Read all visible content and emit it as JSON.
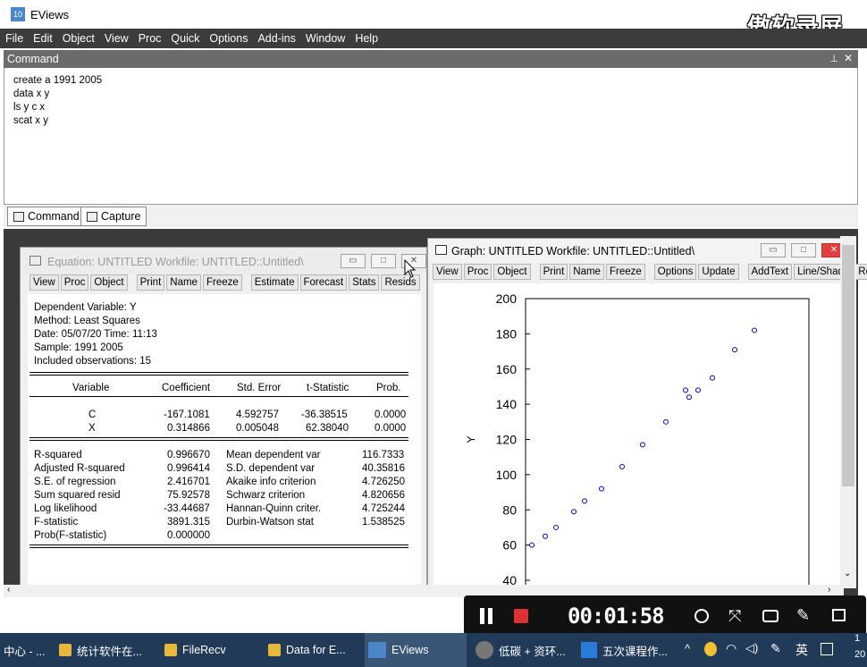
{
  "app": {
    "title": "EViews",
    "watermark": "傲软录屏"
  },
  "menu": [
    "File",
    "Edit",
    "Object",
    "View",
    "Proc",
    "Quick",
    "Options",
    "Add-ins",
    "Window",
    "Help"
  ],
  "command": {
    "header": "Command",
    "lines": [
      "create a 1991 2005",
      "data x y",
      "ls y c x",
      "scat x y"
    ],
    "tabs": [
      "Command",
      "Capture"
    ]
  },
  "equation": {
    "title": "Equation: UNTITLED   Workfile: UNTITLED::Untitled\\",
    "toolbar": [
      "View",
      "Proc",
      "Object",
      "Print",
      "Name",
      "Freeze",
      "Estimate",
      "Forecast",
      "Stats",
      "Resids"
    ],
    "header": [
      "Dependent Variable: Y",
      "Method: Least Squares",
      "Date: 05/07/20   Time: 11:13",
      "Sample: 1991 2005",
      "Included observations: 15"
    ],
    "columns": [
      "Variable",
      "Coefficient",
      "Std. Error",
      "t-Statistic",
      "Prob."
    ],
    "rows": [
      {
        "var": "C",
        "coef": "-167.1081",
        "se": "4.592757",
        "t": "-36.38515",
        "p": "0.0000"
      },
      {
        "var": "X",
        "coef": "0.314866",
        "se": "0.005048",
        "t": "62.38040",
        "p": "0.0000"
      }
    ],
    "stats_left": [
      {
        "label": "R-squared",
        "value": "0.996670"
      },
      {
        "label": "Adjusted R-squared",
        "value": "0.996414"
      },
      {
        "label": "S.E. of regression",
        "value": "2.416701"
      },
      {
        "label": "Sum squared resid",
        "value": "75.92578"
      },
      {
        "label": "Log likelihood",
        "value": "-33.44687"
      },
      {
        "label": "F-statistic",
        "value": "3891.315"
      },
      {
        "label": "Prob(F-statistic)",
        "value": "0.000000"
      }
    ],
    "stats_right": [
      {
        "label": "Mean dependent var",
        "value": "116.7333"
      },
      {
        "label": "S.D. dependent var",
        "value": "40.35816"
      },
      {
        "label": "Akaike info criterion",
        "value": "4.726250"
      },
      {
        "label": "Schwarz criterion",
        "value": "4.820656"
      },
      {
        "label": "Hannan-Quinn criter.",
        "value": "4.725244"
      },
      {
        "label": "Durbin-Watson stat",
        "value": "1.538525"
      }
    ]
  },
  "graph": {
    "title": "Graph: UNTITLED    Workfile: UNTITLED::Untitled\\",
    "toolbar": [
      "View",
      "Proc",
      "Object",
      "Print",
      "Name",
      "Freeze",
      "Options",
      "Update",
      "AddText",
      "Line/Shade",
      "Rer"
    ],
    "point_color": "#0000cc"
  },
  "chart_data": {
    "type": "scatter",
    "ylabel": "Y",
    "yticks": [
      "200",
      "180",
      "160",
      "140",
      "120",
      "100",
      "80",
      "60",
      "40"
    ],
    "ylim": [
      40,
      200
    ],
    "y": [
      60,
      65,
      70,
      79,
      85,
      92,
      104.5,
      117,
      130,
      148,
      144,
      148,
      155,
      171,
      182
    ]
  },
  "recorder": {
    "timer": "00:01:58"
  },
  "taskbar": {
    "items": [
      "中心 - ...",
      "统计软件在...",
      "FileRecv",
      "Data for E...",
      "EViews",
      "低碳 + 资环...",
      "五次课程作..."
    ],
    "ime": "英",
    "clock_partial": [
      "1",
      "20"
    ]
  }
}
